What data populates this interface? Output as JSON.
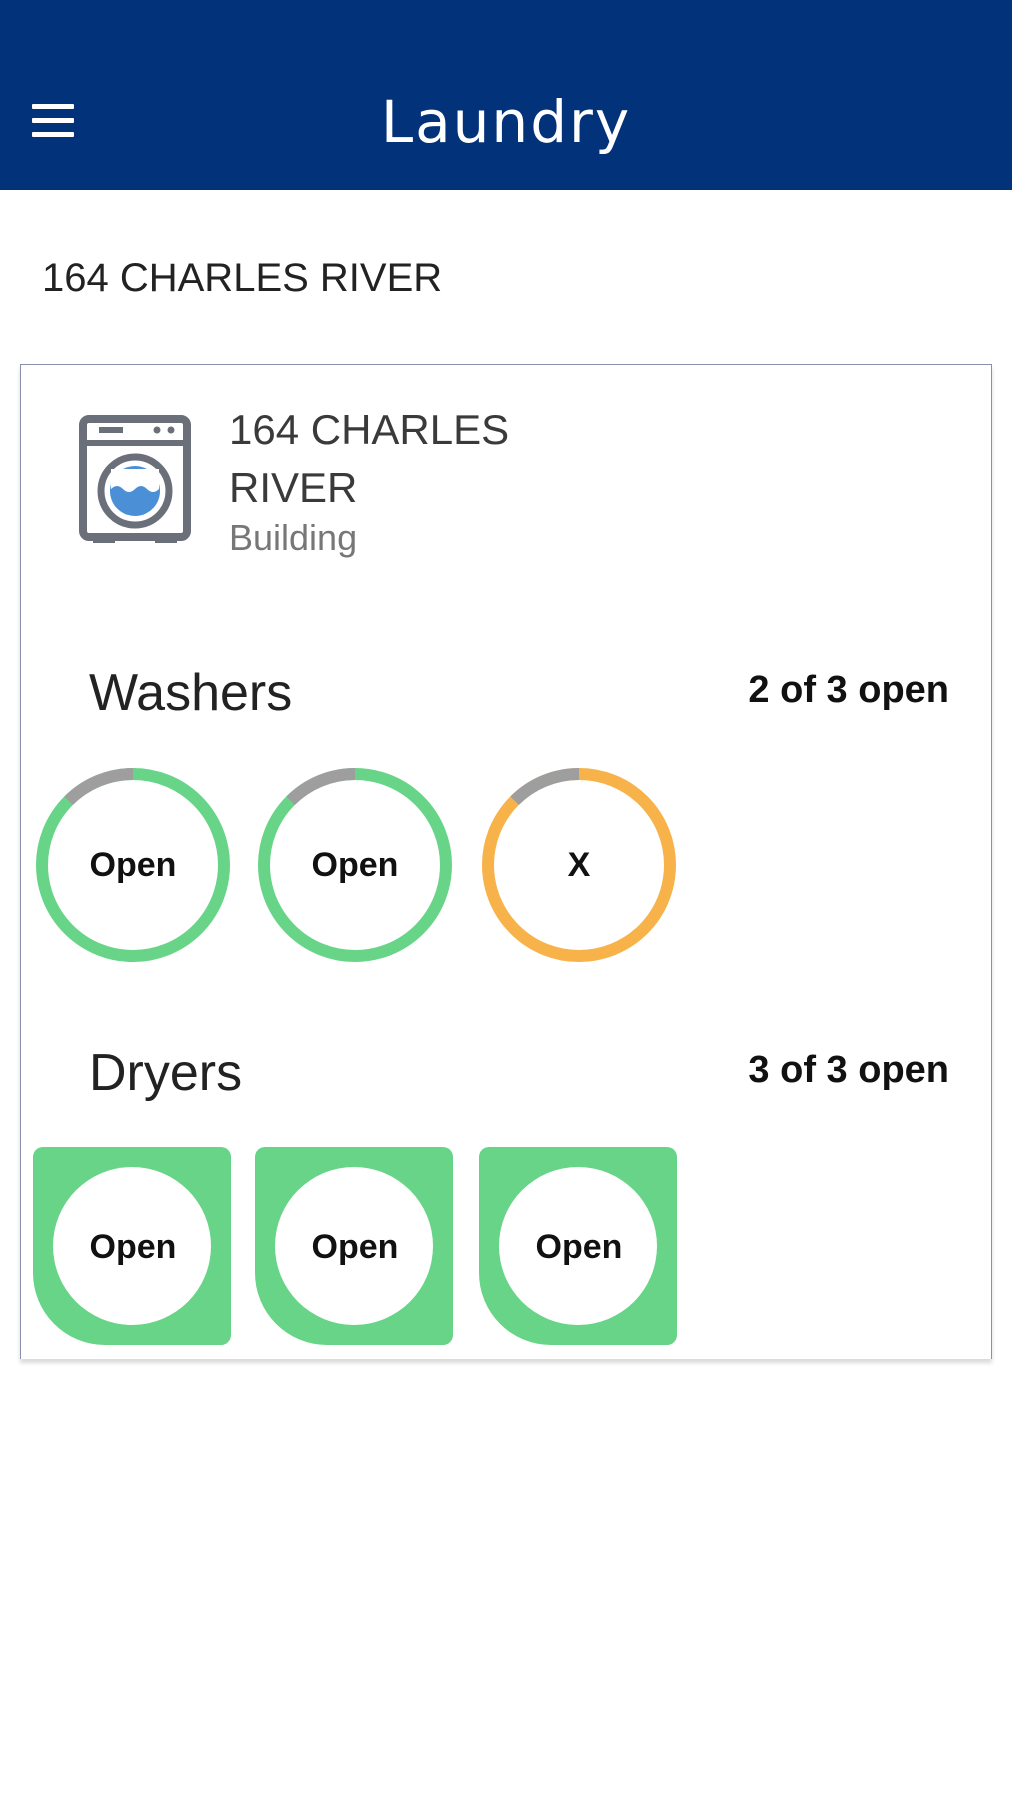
{
  "app": {
    "title": "Laundry"
  },
  "location": {
    "heading": "164 CHARLES RIVER"
  },
  "building": {
    "name": "164 CHARLES RIVER",
    "type": "Building",
    "icon": "washing-machine-icon"
  },
  "washers": {
    "title": "Washers",
    "count": "2 of 3 open",
    "machines": [
      {
        "label": "Open",
        "status": "open",
        "color": "#68d487"
      },
      {
        "label": "Open",
        "status": "open",
        "color": "#68d487"
      },
      {
        "label": "X",
        "status": "unavailable",
        "color": "#f7b24a"
      }
    ]
  },
  "dryers": {
    "title": "Dryers",
    "count": "3 of 3 open",
    "machines": [
      {
        "label": "Open",
        "status": "open",
        "color": "#68d487"
      },
      {
        "label": "Open",
        "status": "open",
        "color": "#68d487"
      },
      {
        "label": "Open",
        "status": "open",
        "color": "#68d487"
      }
    ]
  },
  "colors": {
    "header": "#01327a",
    "open": "#68d487",
    "in_use": "#f7b24a",
    "track": "#9e9e9e"
  }
}
